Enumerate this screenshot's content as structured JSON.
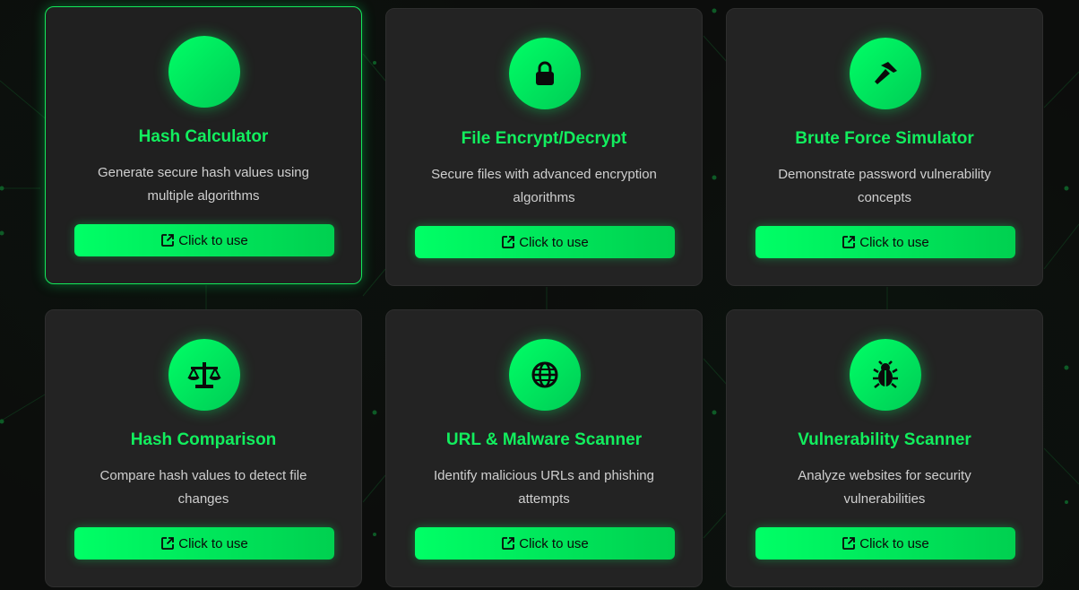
{
  "cards": [
    {
      "title": "Hash Calculator",
      "description": "Generate secure hash values using multiple algorithms",
      "button_label": "Click to use",
      "icon": "hash-icon"
    },
    {
      "title": "File Encrypt/Decrypt",
      "description": "Secure files with advanced encryption algorithms",
      "button_label": "Click to use",
      "icon": "lock-icon"
    },
    {
      "title": "Brute Force Simulator",
      "description": "Demonstrate password vulnerability concepts",
      "button_label": "Click to use",
      "icon": "hammer-icon"
    },
    {
      "title": "Hash Comparison",
      "description": "Compare hash values to detect file changes",
      "button_label": "Click to use",
      "icon": "scale-icon"
    },
    {
      "title": "URL & Malware Scanner",
      "description": "Identify malicious URLs and phishing attempts",
      "button_label": "Click to use",
      "icon": "globe-icon"
    },
    {
      "title": "Vulnerability Scanner",
      "description": "Analyze websites for security vulnerabilities",
      "button_label": "Click to use",
      "icon": "bug-icon"
    }
  ],
  "colors": {
    "accent": "#00ff66",
    "title": "#12ee5e",
    "card_bg": "#232323",
    "page_bg": "#0c0d0c"
  }
}
